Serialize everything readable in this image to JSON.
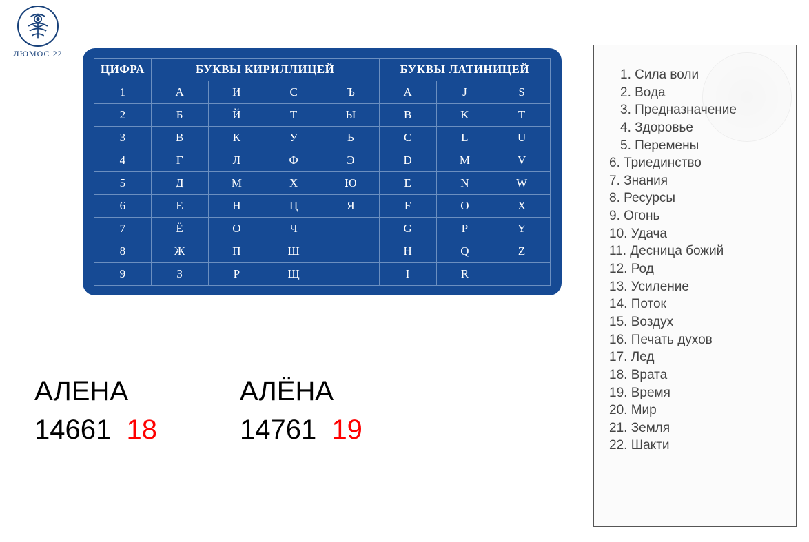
{
  "logo": {
    "text": "ЛЮМОС 22"
  },
  "chart_data": {
    "type": "table",
    "headers": {
      "digit": "ЦИФРА",
      "cyrillic": "БУКВЫ КИРИЛЛИЦЕЙ",
      "latin": "БУКВЫ ЛАТИНИЦЕЙ"
    },
    "rows": [
      {
        "digit": "1",
        "cyr": [
          "А",
          "И",
          "С",
          "Ъ"
        ],
        "lat": [
          "A",
          "J",
          "S"
        ]
      },
      {
        "digit": "2",
        "cyr": [
          "Б",
          "Й",
          "Т",
          "Ы"
        ],
        "lat": [
          "B",
          "K",
          "T"
        ]
      },
      {
        "digit": "3",
        "cyr": [
          "В",
          "К",
          "У",
          "Ь"
        ],
        "lat": [
          "C",
          "L",
          "U"
        ]
      },
      {
        "digit": "4",
        "cyr": [
          "Г",
          "Л",
          "Ф",
          "Э"
        ],
        "lat": [
          "D",
          "M",
          "V"
        ]
      },
      {
        "digit": "5",
        "cyr": [
          "Д",
          "М",
          "Х",
          "Ю"
        ],
        "lat": [
          "E",
          "N",
          "W"
        ]
      },
      {
        "digit": "6",
        "cyr": [
          "Е",
          "Н",
          "Ц",
          "Я"
        ],
        "lat": [
          "F",
          "O",
          "X"
        ]
      },
      {
        "digit": "7",
        "cyr": [
          "Ё",
          "О",
          "Ч",
          ""
        ],
        "lat": [
          "G",
          "P",
          "Y"
        ]
      },
      {
        "digit": "8",
        "cyr": [
          "Ж",
          "П",
          "Ш",
          ""
        ],
        "lat": [
          "H",
          "Q",
          "Z"
        ]
      },
      {
        "digit": "9",
        "cyr": [
          "З",
          "Р",
          "Щ",
          ""
        ],
        "lat": [
          "I",
          "R",
          ""
        ]
      }
    ]
  },
  "names": [
    {
      "name": "АЛЕНА",
      "digits": "14661",
      "sum": "18"
    },
    {
      "name": "АЛЁНА",
      "digits": "14761",
      "sum": "19"
    }
  ],
  "meanings": [
    {
      "n": "1.",
      "text": "Сила воли",
      "indent": true
    },
    {
      "n": "2.",
      "text": "Вода",
      "indent": true
    },
    {
      "n": "3.",
      "text": "Предназначение",
      "indent": true
    },
    {
      "n": "4.",
      "text": "Здоровье",
      "indent": true
    },
    {
      "n": "5.",
      "text": "Перемены",
      "indent": true
    },
    {
      "n": "6.",
      "text": "Триединство",
      "indent": false
    },
    {
      "n": "7.",
      "text": "Знания",
      "indent": false
    },
    {
      "n": "8.",
      "text": "Ресурсы",
      "indent": false
    },
    {
      "n": "9.",
      "text": "Огонь",
      "indent": false
    },
    {
      "n": "10.",
      "text": "Удача",
      "indent": false
    },
    {
      "n": "11.",
      "text": "Десница божий",
      "indent": false
    },
    {
      "n": "12.",
      "text": "Род",
      "indent": false
    },
    {
      "n": "13.",
      "text": "Усиление",
      "indent": false
    },
    {
      "n": "14.",
      "text": "Поток",
      "indent": false
    },
    {
      "n": "15.",
      "text": "Воздух",
      "indent": false
    },
    {
      "n": "16.",
      "text": "Печать духов",
      "indent": false
    },
    {
      "n": "17.",
      "text": "Лед",
      "indent": false
    },
    {
      "n": "18.",
      "text": "Врата",
      "indent": false
    },
    {
      "n": "19.",
      "text": "Время",
      "indent": false
    },
    {
      "n": "20.",
      "text": "Мир",
      "indent": false
    },
    {
      "n": "21.",
      "text": "Земля",
      "indent": false
    },
    {
      "n": "22.",
      "text": "Шакти",
      "indent": false
    }
  ]
}
